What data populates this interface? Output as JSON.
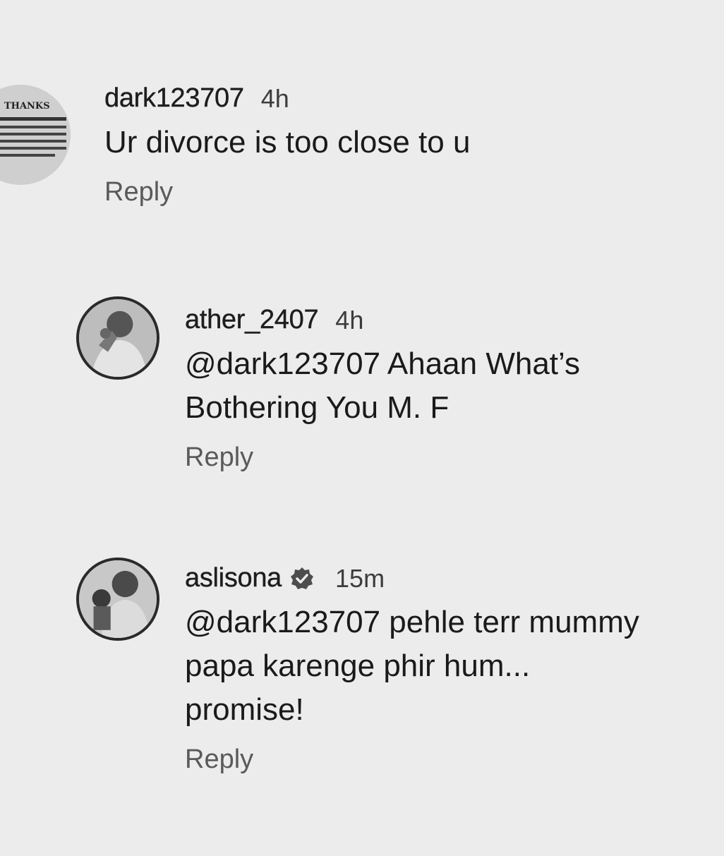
{
  "comments": [
    {
      "username": "dark123707",
      "time": "4h",
      "verified": false,
      "avatar_icon": "newspaper-avatar",
      "avatar_text": "THANKS",
      "lines": [
        "Ur divorce is too close to u"
      ],
      "reply_label": "Reply"
    },
    {
      "username": "ather_2407",
      "time": "4h",
      "verified": false,
      "avatar_icon": "person-photo-avatar",
      "lines": [
        "@dark123707 Ahaan What’s",
        "Bothering You M. F"
      ],
      "reply_label": "Reply"
    },
    {
      "username": "aslisona",
      "time": "15m",
      "verified": true,
      "verified_icon": "verified-badge-icon",
      "avatar_icon": "person-photo-avatar",
      "lines": [
        "@dark123707 pehle terr mummy",
        "papa karenge phir hum...",
        "promise!"
      ],
      "reply_label": "Reply"
    }
  ]
}
